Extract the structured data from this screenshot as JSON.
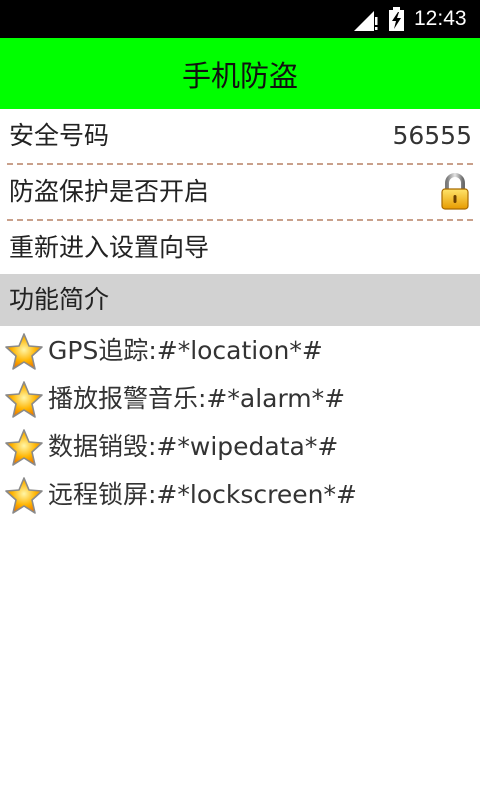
{
  "status_bar": {
    "time": "12:43",
    "icons": [
      "signal-icon",
      "battery-icon"
    ]
  },
  "header": {
    "title": "手机防盗"
  },
  "settings": {
    "safe_number_label": "安全号码",
    "safe_number_value": "56555",
    "protection_label": "防盗保护是否开启",
    "protection_icon": "lock-icon",
    "wizard_label": "重新进入设置向导"
  },
  "intro": {
    "title": "功能简介",
    "items": [
      {
        "icon": "star-icon",
        "text": "GPS追踪:#*location*#"
      },
      {
        "icon": "star-icon",
        "text": "播放报警音乐:#*alarm*#"
      },
      {
        "icon": "star-icon",
        "text": "数据销毁:#*wipedata*#"
      },
      {
        "icon": "star-icon",
        "text": "远程锁屏:#*lockscreen*#"
      }
    ]
  },
  "colors": {
    "title_bar": "#00ff00",
    "section_bg": "#d2d2d2",
    "divider": "#c9a08b",
    "status_bar": "#000000"
  }
}
